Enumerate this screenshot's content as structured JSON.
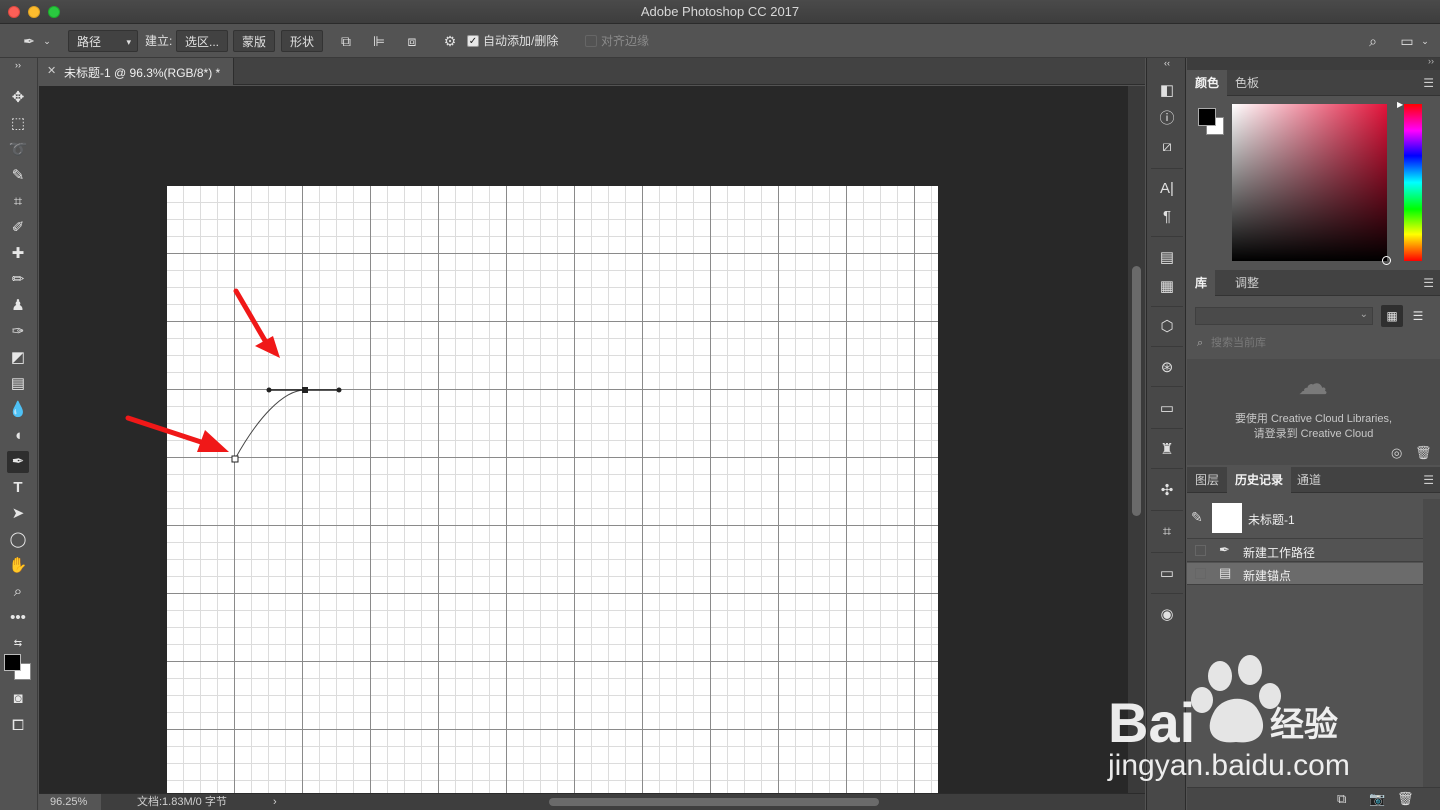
{
  "window": {
    "title": "Adobe Photoshop CC 2017"
  },
  "options_bar": {
    "mode": "路径",
    "make_label": "建立:",
    "selection_btn": "选区...",
    "mask_btn": "蒙版",
    "shape_btn": "形状",
    "auto_add_delete": {
      "label": "自动添加/删除",
      "checked": true
    },
    "align_edges": {
      "label": "对齐边缘",
      "checked": false
    }
  },
  "document_tab": {
    "title": "未标题-1 @ 96.3%(RGB/8*) *"
  },
  "status_bar": {
    "zoom": "96.25%",
    "doc_info": "文档:1.83M/0 字节"
  },
  "panels": {
    "color": {
      "tabs": [
        "颜色",
        "色板"
      ],
      "active": 0,
      "foreground": "#000000",
      "background": "#ffffff"
    },
    "library": {
      "tabs": [
        "库",
        "调整"
      ],
      "search_placeholder": "搜索当前库",
      "message_line1": "要使用 Creative Cloud Libraries,",
      "message_line2": "请登录到 Creative Cloud"
    },
    "history": {
      "tabs": [
        "图层",
        "历史记录",
        "通道"
      ],
      "active": 1,
      "snapshot": "未标题-1",
      "items": [
        {
          "label": "新建工作路径",
          "icon": "pen-icon",
          "selected": false
        },
        {
          "label": "新建锚点",
          "icon": "document-icon",
          "selected": true
        }
      ]
    }
  },
  "watermark": {
    "brand": "Bai",
    "brand_suffix": "经验",
    "url": "jingyan.baidu.com"
  }
}
